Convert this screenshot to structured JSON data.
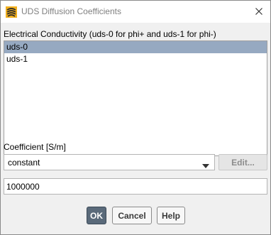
{
  "window": {
    "title": "UDS Diffusion Coefficients",
    "app_icon": "ansys-fluent-icon",
    "close_icon": "close-icon"
  },
  "uds_list": {
    "label": "Electrical Conductivity (uds-0 for phi+ and uds-1 for phi-)",
    "items": [
      {
        "label": "uds-0",
        "selected": true
      },
      {
        "label": "uds-1",
        "selected": false
      }
    ],
    "selected_color": "#96a9c1"
  },
  "coefficient": {
    "label": "Coefficient [S/m]",
    "method": {
      "value": "constant",
      "icon": "chevron-down-icon"
    },
    "edit_label": "Edit...",
    "value": "1000000"
  },
  "buttons": {
    "ok": "OK",
    "cancel": "Cancel",
    "help": "Help"
  }
}
